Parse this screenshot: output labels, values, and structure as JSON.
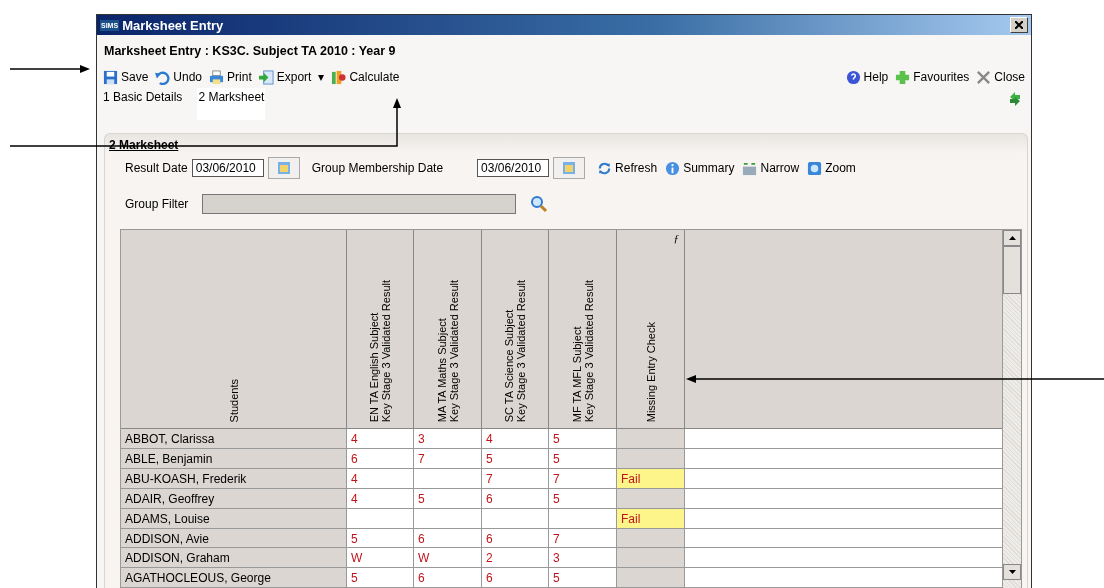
{
  "window": {
    "logo": "SIMS",
    "title": "Marksheet Entry"
  },
  "heading": "Marksheet Entry : KS3C. Subject TA 2010 : Year 9",
  "toolbar": [
    {
      "kind": "save",
      "label": "Save"
    },
    {
      "kind": "undo",
      "label": "Undo"
    },
    {
      "kind": "print",
      "label": "Print"
    },
    {
      "kind": "export",
      "label": "Export"
    },
    {
      "kind": "dropdown",
      "label": "▾"
    },
    {
      "kind": "calculate",
      "label": "Calculate"
    }
  ],
  "toolbar_right": [
    {
      "kind": "help",
      "label": "Help"
    },
    {
      "kind": "favourites",
      "label": "Favourites"
    },
    {
      "kind": "close",
      "label": "Close"
    }
  ],
  "tabs": [
    {
      "label": "1 Basic Details",
      "selected": false
    },
    {
      "label": "2 Marksheet",
      "selected": true
    }
  ],
  "panel": {
    "title": "2 Marksheet",
    "result_date": {
      "label": "Result Date",
      "value": "03/06/2010"
    },
    "membership_date": {
      "label": "Group Membership Date",
      "value": "03/06/2010"
    },
    "actions": [
      {
        "kind": "refresh",
        "label": "Refresh"
      },
      {
        "kind": "summary",
        "label": "Summary"
      },
      {
        "kind": "narrow",
        "label": "Narrow"
      },
      {
        "kind": "zoom",
        "label": "Zoom"
      }
    ],
    "group_filter": {
      "label": "Group Filter"
    }
  },
  "table": {
    "columns": [
      {
        "label": "Students"
      },
      {
        "label": "EN TA English Subject\nKey Stage 3 Validated Result"
      },
      {
        "label": "MA TA Maths Subject\nKey Stage 3 Validated Result"
      },
      {
        "label": "SC TA Science Subject\nKey Stage 3 Validated Result"
      },
      {
        "label": "MF TA MFL Subject\nKey Stage 3 Validated Result"
      },
      {
        "label": "Missing Entry Check",
        "formula_mark": "ƒ"
      }
    ],
    "rows": [
      {
        "student": "ABBOT, Clarissa",
        "marks": {
          "en": "4",
          "ma": "3",
          "sc": "4",
          "mf": "5"
        },
        "failed": false
      },
      {
        "student": "ABLE, Benjamin",
        "marks": {
          "en": "6",
          "ma": "7",
          "sc": "5",
          "mf": "5"
        },
        "failed": false
      },
      {
        "student": "ABU-KOASH, Frederik",
        "marks": {
          "en": "4",
          "sc": "7",
          "mf": "7"
        },
        "check": "Fail",
        "failed": true
      },
      {
        "student": "ADAIR, Geoffrey",
        "marks": {
          "en": "4",
          "ma": "5",
          "sc": "6",
          "mf": "5"
        },
        "failed": false
      },
      {
        "student": "ADAMS, Louise",
        "check": "Fail",
        "failed": true
      },
      {
        "student": "ADDISON, Avie",
        "marks": {
          "en": "5",
          "ma": "6",
          "sc": "6",
          "mf": "7"
        },
        "failed": false
      },
      {
        "student": "ADDISON, Graham",
        "marks": {
          "en": "W",
          "ma": "W",
          "sc": "2",
          "mf": "3"
        },
        "failed": false
      },
      {
        "student": "AGATHOCLEOUS, George",
        "marks": {
          "en": "5",
          "ma": "6",
          "sc": "6",
          "mf": "5"
        },
        "failed": false
      }
    ]
  }
}
